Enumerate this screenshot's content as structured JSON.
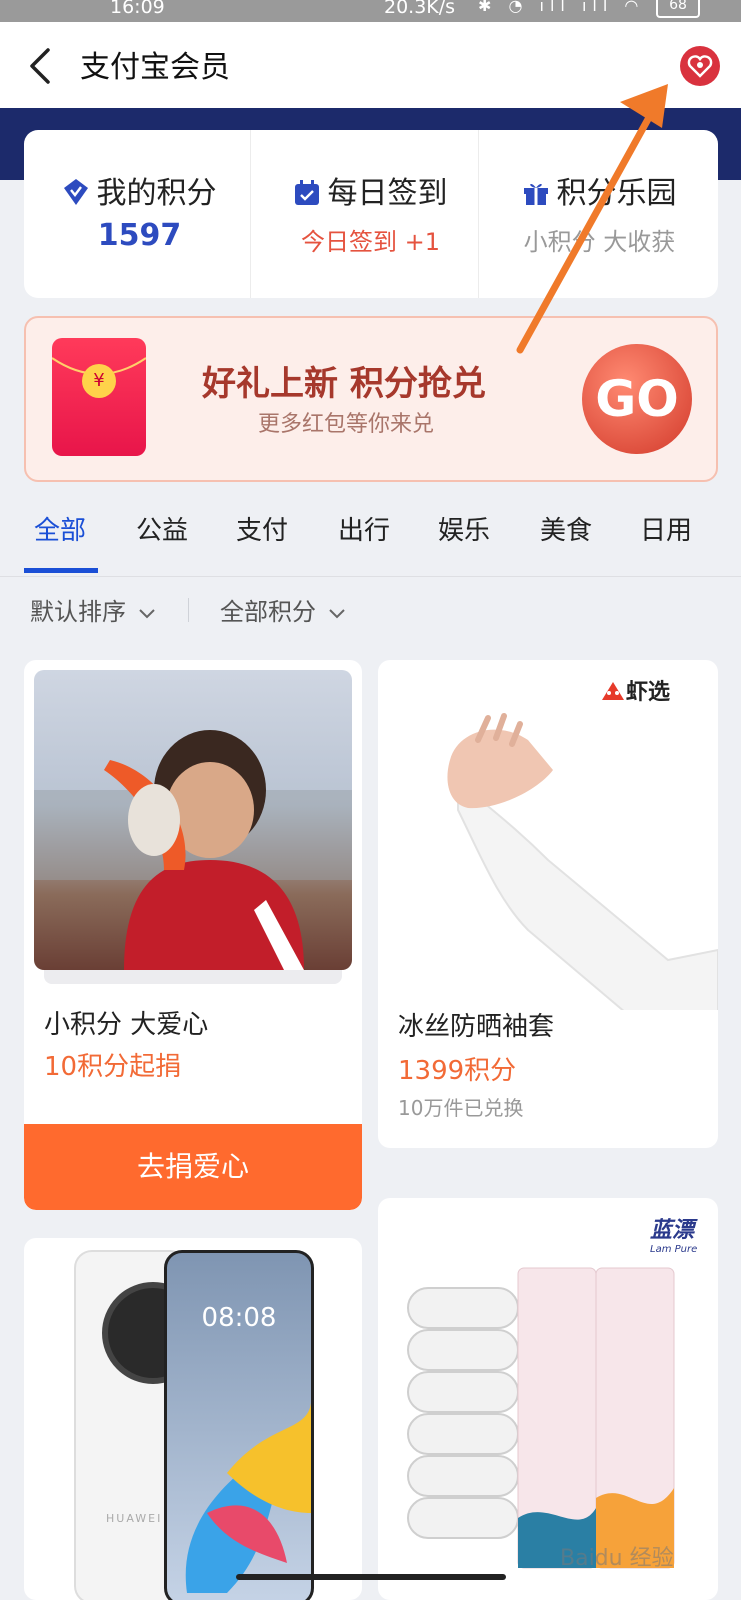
{
  "status_bar": {
    "time": "16:09",
    "net_speed": "20.3K/s",
    "icons": "✱ ◔ ıll ıll ◠",
    "battery": "68"
  },
  "header": {
    "title": "支付宝会员",
    "back_icon": "chevron-left-icon",
    "right_icon": "heart-badge-icon"
  },
  "summary": {
    "points": {
      "label": "我的积分",
      "value": "1597",
      "icon": "shield-check-icon"
    },
    "checkin": {
      "label": "每日签到",
      "value": "今日签到 +1",
      "icon": "calendar-check-icon"
    },
    "park": {
      "label": "积分乐园",
      "value": "小积分 大收获",
      "icon": "gift-icon"
    }
  },
  "banner": {
    "title": "好礼上新 积分抢兑",
    "subtitle": "更多红包等你来兑",
    "go_label": "GO",
    "coin": "¥"
  },
  "tabs": [
    "全部",
    "公益",
    "支付",
    "出行",
    "娱乐",
    "美食",
    "日用"
  ],
  "active_tab": 0,
  "filters": {
    "sort": "默认排序",
    "range": "全部积分"
  },
  "products": [
    {
      "name": "小积分 大爱心",
      "price": "10积分起捐",
      "button": "去捐爱心"
    },
    {
      "name": "冰丝防晒袖套",
      "price": "1399积分",
      "note": "10万件已兑换",
      "brand": "虾选"
    },
    {
      "brand": "HUAWEI",
      "screen_time": "08:08"
    },
    {
      "brand": "蓝漂",
      "brand_en": "Lam Pure"
    }
  ],
  "watermark": "Baidu 经验",
  "colors": {
    "accent": "#1a4fd6",
    "orange": "#ff6a2e",
    "banner_red": "#a6382c",
    "band": "#1c2a6b"
  }
}
